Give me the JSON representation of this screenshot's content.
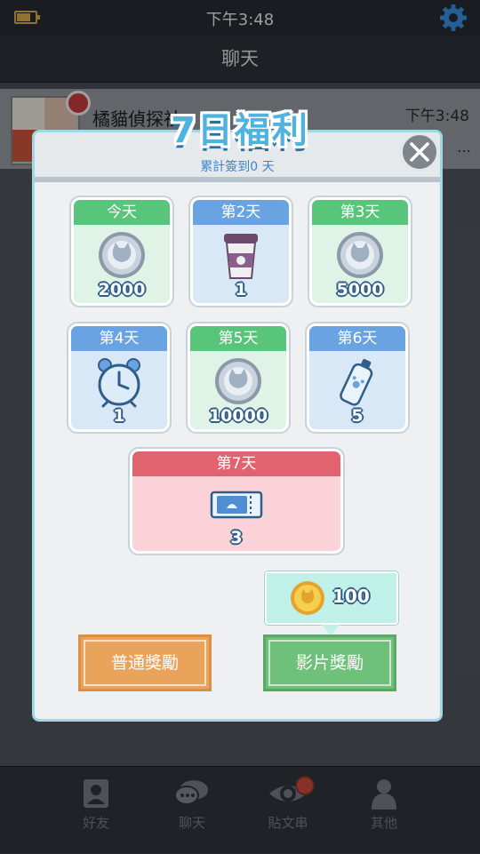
{
  "statusbar": {
    "time": "下午3:48"
  },
  "header": {
    "title": "聊天"
  },
  "chat": {
    "name": "橘貓偵探社",
    "time": "下午3:48",
    "preview_ellipsis": "…"
  },
  "navbar": {
    "items": [
      {
        "label": "好友",
        "icon": "contacts-icon"
      },
      {
        "label": "聊天",
        "icon": "chat-bubble-icon"
      },
      {
        "label": "貼文串",
        "icon": "eye-icon",
        "badge": true
      },
      {
        "label": "其他",
        "icon": "person-icon"
      }
    ]
  },
  "modal": {
    "title": "7日福利",
    "subtitle": "累計簽到0 天",
    "rewards": [
      {
        "day": "今天",
        "item": "coin-icon",
        "amount": "2000",
        "style": "green"
      },
      {
        "day": "第2天",
        "item": "coffee-cup-icon",
        "amount": "1",
        "style": "blue"
      },
      {
        "day": "第3天",
        "item": "coin-icon",
        "amount": "5000",
        "style": "green"
      },
      {
        "day": "第4天",
        "item": "alarm-clock-icon",
        "amount": "1",
        "style": "blue"
      },
      {
        "day": "第5天",
        "item": "coin-icon",
        "amount": "10000",
        "style": "green"
      },
      {
        "day": "第6天",
        "item": "spray-bottle-icon",
        "amount": "5",
        "style": "blue"
      },
      {
        "day": "第7天",
        "item": "ticket-icon",
        "amount": "3",
        "style": "pink"
      }
    ],
    "video_bonus": "100",
    "normal_button": "普通獎勵",
    "video_button": "影片獎勵"
  },
  "colors": {
    "accent_blue": "#4fb3df",
    "green_header": "#58c57b",
    "blue_header": "#6aa3e1",
    "pink_header": "#e0636f",
    "normal_button": "#eaa35a",
    "video_button": "#6ec07a"
  }
}
